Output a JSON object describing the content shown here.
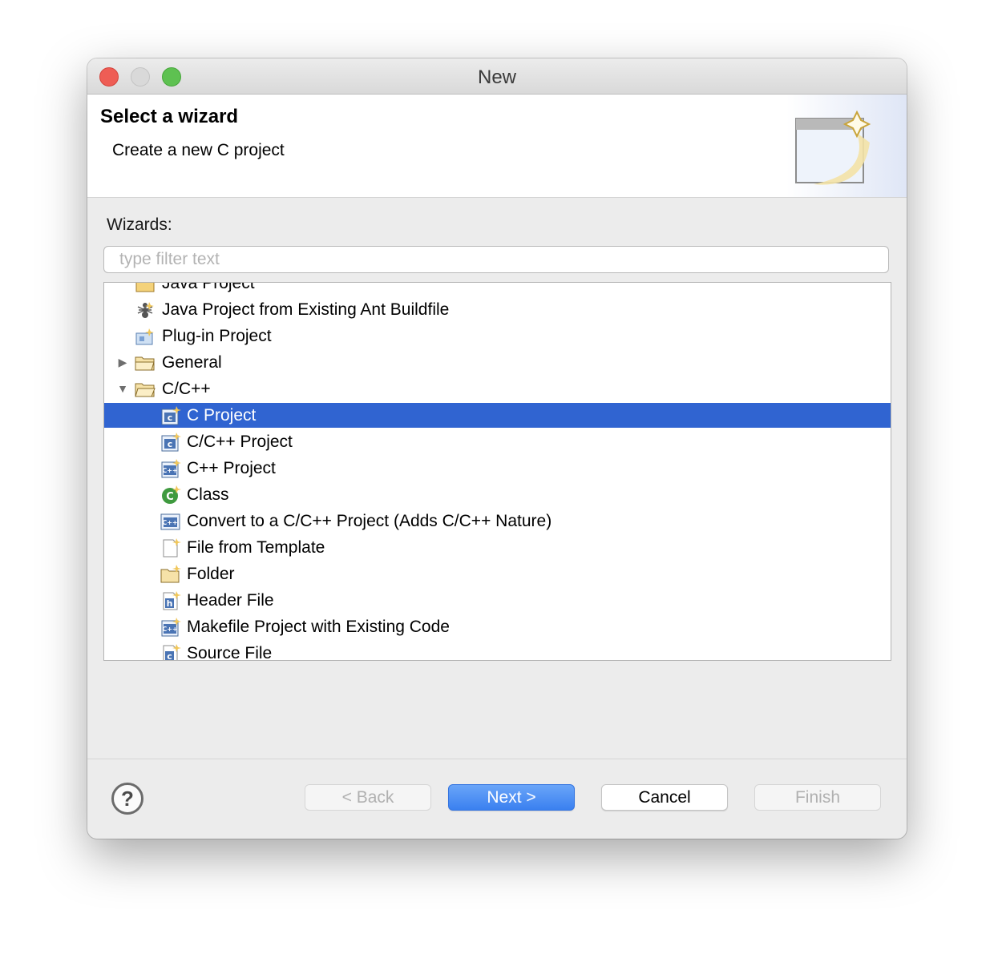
{
  "window": {
    "title": "New",
    "controls": [
      "close",
      "minimize",
      "maximize"
    ]
  },
  "header": {
    "title": "Select a wizard",
    "description": "Create a new C project",
    "banner_icon": "new-wizard-banner-icon"
  },
  "wizards": {
    "label": "Wizards:",
    "filter_placeholder": "type filter text",
    "filter_value": "",
    "items": [
      {
        "label": "Java Project",
        "icon": "java-project-icon",
        "level": 1
      },
      {
        "label": "Java Project from Existing Ant Buildfile",
        "icon": "ant-icon",
        "level": 1
      },
      {
        "label": "Plug-in Project",
        "icon": "plugin-project-icon",
        "level": 1
      },
      {
        "label": "General",
        "icon": "folder-icon",
        "level": 0,
        "expanded": false
      },
      {
        "label": "C/C++",
        "icon": "folder-open-icon",
        "level": 0,
        "expanded": true
      },
      {
        "label": "C Project",
        "icon": "c-project-icon",
        "level": 2,
        "selected": true
      },
      {
        "label": "C/C++ Project",
        "icon": "c-project-icon",
        "level": 2
      },
      {
        "label": "C++ Project",
        "icon": "cpp-project-icon",
        "level": 2
      },
      {
        "label": "Class",
        "icon": "class-icon",
        "level": 2
      },
      {
        "label": "Convert to a C/C++ Project (Adds C/C++ Nature)",
        "icon": "convert-icon",
        "level": 2
      },
      {
        "label": "File from Template",
        "icon": "file-icon",
        "level": 2
      },
      {
        "label": "Folder",
        "icon": "new-folder-icon",
        "level": 2
      },
      {
        "label": "Header File",
        "icon": "header-file-icon",
        "level": 2
      },
      {
        "label": "Makefile Project with Existing Code",
        "icon": "cpp-project-icon",
        "level": 2
      },
      {
        "label": "Source File",
        "icon": "source-file-icon",
        "level": 2
      }
    ]
  },
  "buttons": {
    "help_glyph": "?",
    "back": "< Back",
    "next": "Next >",
    "cancel": "Cancel",
    "finish": "Finish"
  },
  "colors": {
    "selection": "#3064d1",
    "primary_button": "#3a80f0",
    "close": "#ee5d55",
    "maximize": "#5ec151"
  }
}
